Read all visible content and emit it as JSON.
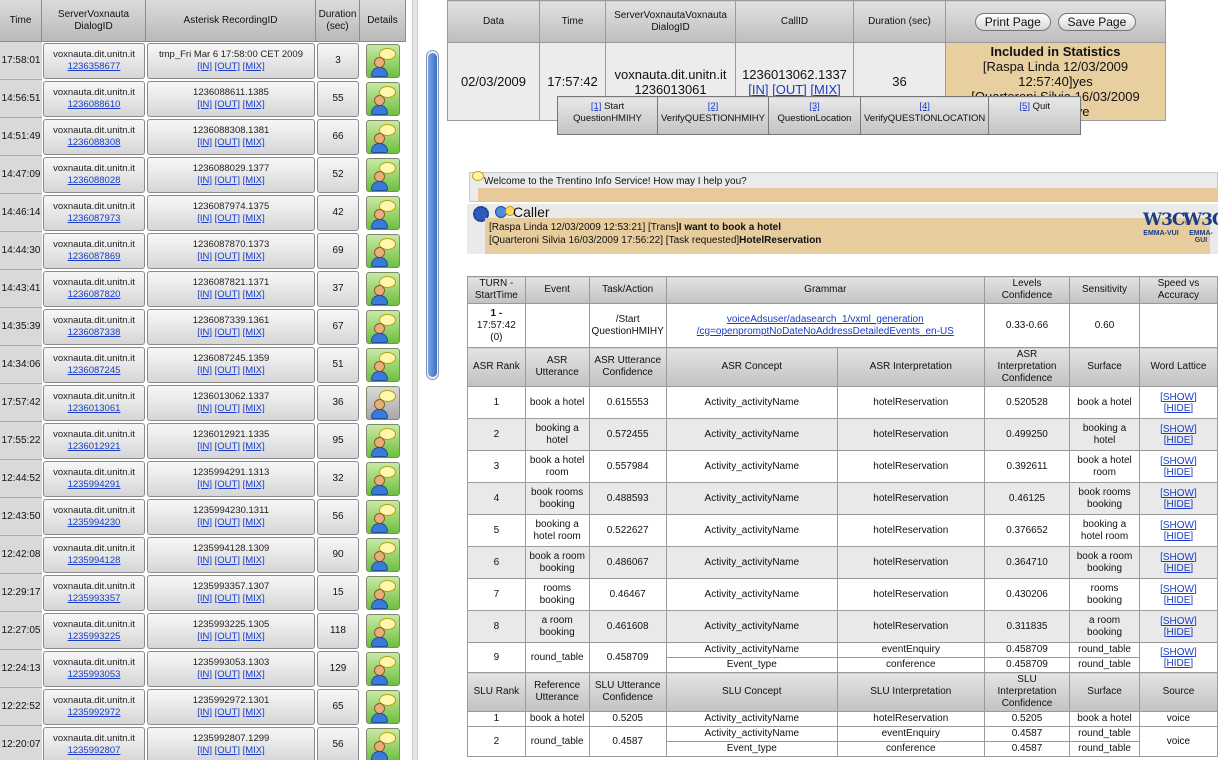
{
  "left": {
    "headers": {
      "time": "Time",
      "server": "ServerVoxnauta DialogID",
      "recording": "Asterisk RecordingID",
      "duration": "Duration (sec)",
      "details": "Details"
    },
    "link_in": "[IN]",
    "link_out": "[OUT]",
    "link_mix": "[MIX]",
    "rows": [
      {
        "time": "17:58:01",
        "server": "voxnauta.dit.unitn.it",
        "dialog": "1236358677",
        "rec": "tmp_Fri Mar 6 17:58:00 CET 2009",
        "dur": "3"
      },
      {
        "time": "14:56:51",
        "server": "voxnauta.dit.unitn.it",
        "dialog": "1236088610",
        "rec": "1236088611.1385",
        "dur": "55"
      },
      {
        "time": "14:51:49",
        "server": "voxnauta.dit.unitn.it",
        "dialog": "1236088308",
        "rec": "1236088308.1381",
        "dur": "66"
      },
      {
        "time": "14:47:09",
        "server": "voxnauta.dit.unitn.it",
        "dialog": "1236088028",
        "rec": "1236088029.1377",
        "dur": "52"
      },
      {
        "time": "14:46:14",
        "server": "voxnauta.dit.unitn.it",
        "dialog": "1236087973",
        "rec": "1236087974.1375",
        "dur": "42"
      },
      {
        "time": "14:44:30",
        "server": "voxnauta.dit.unitn.it",
        "dialog": "1236087869",
        "rec": "1236087870.1373",
        "dur": "69"
      },
      {
        "time": "14:43:41",
        "server": "voxnauta.dit.unitn.it",
        "dialog": "1236087820",
        "rec": "1236087821.1371",
        "dur": "37"
      },
      {
        "time": "14:35:39",
        "server": "voxnauta.dit.unitn.it",
        "dialog": "1236087338",
        "rec": "1236087339.1361",
        "dur": "67"
      },
      {
        "time": "14:34:06",
        "server": "voxnauta.dit.unitn.it",
        "dialog": "1236087245",
        "rec": "1236087245.1359",
        "dur": "51"
      },
      {
        "time": "17:57:42",
        "server": "voxnauta.dit.unitn.it",
        "dialog": "1236013061",
        "rec": "1236013062.1337",
        "dur": "36"
      },
      {
        "time": "17:55:22",
        "server": "voxnauta.dit.unitn.it",
        "dialog": "1236012921",
        "rec": "1236012921.1335",
        "dur": "95"
      },
      {
        "time": "12:44:52",
        "server": "voxnauta.dit.unitn.it",
        "dialog": "1235994291",
        "rec": "1235994291.1313",
        "dur": "32"
      },
      {
        "time": "12:43:50",
        "server": "voxnauta.dit.unitn.it",
        "dialog": "1235994230",
        "rec": "1235994230.1311",
        "dur": "56"
      },
      {
        "time": "12:42:08",
        "server": "voxnauta.dit.unitn.it",
        "dialog": "1235994128",
        "rec": "1235994128.1309",
        "dur": "90"
      },
      {
        "time": "12:29:17",
        "server": "voxnauta.dit.unitn.it",
        "dialog": "1235993357",
        "rec": "1235993357.1307",
        "dur": "15"
      },
      {
        "time": "12:27:05",
        "server": "voxnauta.dit.unitn.it",
        "dialog": "1235993225",
        "rec": "1235993225.1305",
        "dur": "118"
      },
      {
        "time": "12:24:13",
        "server": "voxnauta.dit.unitn.it",
        "dialog": "1235993053",
        "rec": "1235993053.1303",
        "dur": "129"
      },
      {
        "time": "12:22:52",
        "server": "voxnauta.dit.unitn.it",
        "dialog": "1235992972",
        "rec": "1235992972.1301",
        "dur": "65"
      },
      {
        "time": "12:20:07",
        "server": "voxnauta.dit.unitn.it",
        "dialog": "1235992807",
        "rec": "1235992807.1299",
        "dur": "56"
      }
    ]
  },
  "header": {
    "cols": {
      "data": "Data",
      "time": "Time",
      "server": "ServerVoxnautaVoxnauta DialogID",
      "callid": "CallID",
      "duration": "Duration (sec)"
    },
    "print_label": "Print Page",
    "save_label": "Save Page",
    "date": "02/03/2009",
    "time": "17:57:42",
    "server": "voxnauta.dit.unitn.it",
    "dialog": "1236013061",
    "callid": "1236013062.1337",
    "duration": "36",
    "stats_title": "Included in Statistics",
    "stats_line1": "[Raspa Linda 12/03/2009 12:57:40]yes",
    "stats_line2": "[Quarteroni Silvia 16/03/2009 17:57:23]ye"
  },
  "tabs": [
    {
      "num": "[1]",
      "label": "Start QuestionHMIHY"
    },
    {
      "num": "[2]",
      "label": "VerifyQUESTIONHMIHY"
    },
    {
      "num": "[3]",
      "label": "QuestionLocation"
    },
    {
      "num": "[4]",
      "label": "VerifyQUESTIONLOCATION"
    },
    {
      "num": "[5]",
      "label": "Quit"
    }
  ],
  "welcome": "Welcome to the Trentino Info Service! How may I help you?",
  "caller": {
    "title": "Caller",
    "line1_prefix": "[Raspa Linda 12/03/2009 12:53:21] [Trans]",
    "line1_bold": "I want to book a hotel",
    "line2_prefix": "[Quarteroni Silvia 16/03/2009 17:56:22] [Task requested]",
    "line2_bold": "HotelReservation",
    "w3c": "W3C",
    "w3c_sup": "®",
    "emma_vui": "EMMA-VUI",
    "emma_gui": "EMMA-GUI"
  },
  "turn": {
    "headers": {
      "turn": "TURN - StartTime",
      "event": "Event",
      "task": "Task/Action",
      "grammar": "Grammar",
      "levels": "Levels Confidence",
      "sensitivity": "Sensitivity",
      "speed": "Speed vs Accuracy"
    },
    "num": "1 -",
    "start": "17:57:42",
    "idx": "(0)",
    "task": "/Start QuestionHMIHY",
    "grammar1": "voiceAdsuser/adasearch_1/vxml_generation",
    "grammar2": "/cg=openpromptNoDateNoAddressDetailedEvents_en-US",
    "levels": "0.33-0.66",
    "sensitivity": "0.60"
  },
  "asr": {
    "headers": {
      "rank": "ASR Rank",
      "utt": "ASR Utterance",
      "uttconf": "ASR Utterance Confidence",
      "concept": "ASR Concept",
      "interp": "ASR Interpretation",
      "interpconf": "ASR Interpretation Confidence",
      "surface": "Surface",
      "lattice": "Word Lattice"
    },
    "show": "[SHOW]",
    "hide": "[HIDE]",
    "rows": [
      {
        "rank": "1",
        "utt": "book a hotel",
        "conf": "0.615553",
        "concept": "Activity_activityName",
        "interp": "hotelReservation",
        "iconf": "0.520528",
        "surface": "book a hotel"
      },
      {
        "rank": "2",
        "utt": "booking a hotel",
        "conf": "0.572455",
        "concept": "Activity_activityName",
        "interp": "hotelReservation",
        "iconf": "0.499250",
        "surface": "booking a hotel"
      },
      {
        "rank": "3",
        "utt": "book a hotel room",
        "conf": "0.557984",
        "concept": "Activity_activityName",
        "interp": "hotelReservation",
        "iconf": "0.392611",
        "surface": "book a hotel room"
      },
      {
        "rank": "4",
        "utt": "book rooms booking",
        "conf": "0.488593",
        "concept": "Activity_activityName",
        "interp": "hotelReservation",
        "iconf": "0.46125",
        "surface": "book rooms booking"
      },
      {
        "rank": "5",
        "utt": "booking a hotel room",
        "conf": "0.522627",
        "concept": "Activity_activityName",
        "interp": "hotelReservation",
        "iconf": "0.376652",
        "surface": "booking a hotel room"
      },
      {
        "rank": "6",
        "utt": "book a room booking",
        "conf": "0.486067",
        "concept": "Activity_activityName",
        "interp": "hotelReservation",
        "iconf": "0.364710",
        "surface": "book a room booking"
      },
      {
        "rank": "7",
        "utt": "rooms booking",
        "conf": "0.46467",
        "concept": "Activity_activityName",
        "interp": "hotelReservation",
        "iconf": "0.430206",
        "surface": "rooms booking"
      },
      {
        "rank": "8",
        "utt": "a room booking",
        "conf": "0.461608",
        "concept": "Activity_activityName",
        "interp": "hotelReservation",
        "iconf": "0.311835",
        "surface": "a room booking"
      }
    ],
    "row9": {
      "rank": "9",
      "utt": "round_table",
      "conf": "0.458709",
      "concept1": "Activity_activityName",
      "concept2": "Event_type",
      "interp1": "eventEnquiry",
      "interp2": "conference",
      "iconf1": "0.458709",
      "iconf2": "0.458709",
      "surface1": "round_table",
      "surface2": "round_table"
    }
  },
  "slu": {
    "headers": {
      "rank": "SLU Rank",
      "ref": "Reference Utterance",
      "uttconf": "SLU Utterance Confidence",
      "concept": "SLU Concept",
      "interp": "SLU Interpretation",
      "interpconf": "SLU Interpretation Confidence",
      "surface": "Surface",
      "source": "Source"
    },
    "row1": {
      "rank": "1",
      "ref": "book a hotel",
      "conf": "0.5205",
      "concept": "Activity_activityName",
      "interp": "hotelReservation",
      "iconf": "0.5205",
      "surface": "book a hotel",
      "source": "voice"
    },
    "row2": {
      "rank": "2",
      "ref": "round_table",
      "conf": "0.4587",
      "concept1": "Activity_activityName",
      "concept2": "Event_type",
      "interp1": "eventEnquiry",
      "interp2": "conference",
      "iconf1": "0.4587",
      "iconf2": "0.4587",
      "surface1": "round_table",
      "surface2": "round_table",
      "source": "voice"
    }
  }
}
